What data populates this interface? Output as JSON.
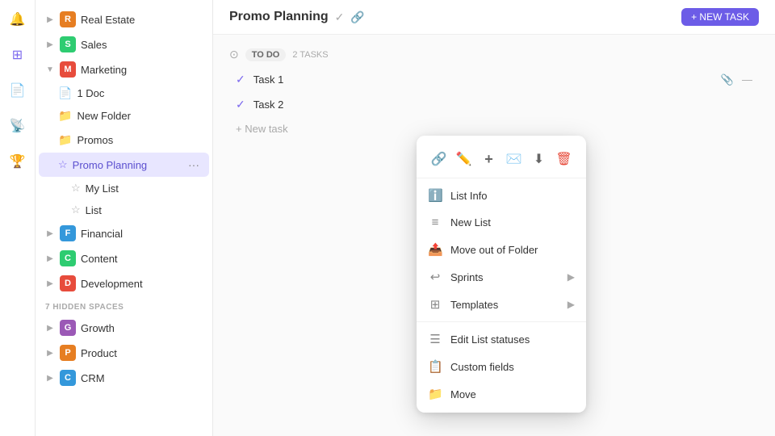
{
  "iconBar": {
    "icons": [
      {
        "name": "bell-icon",
        "symbol": "🔔"
      },
      {
        "name": "grid-icon",
        "symbol": "⊞"
      },
      {
        "name": "doc-icon",
        "symbol": "📄"
      },
      {
        "name": "radio-icon",
        "symbol": "📡"
      },
      {
        "name": "trophy-icon",
        "symbol": "🏆"
      }
    ]
  },
  "sidebar": {
    "spaces": [
      {
        "id": "real-estate",
        "label": "Real Estate",
        "color": "#e67e22",
        "initial": "R",
        "collapsed": true
      },
      {
        "id": "sales",
        "label": "Sales",
        "color": "#2ecc71",
        "initial": "S",
        "collapsed": true
      },
      {
        "id": "marketing",
        "label": "Marketing",
        "color": "#e74c3c",
        "initial": "M",
        "collapsed": false
      }
    ],
    "marketingItems": [
      {
        "type": "doc",
        "label": "1 Doc"
      },
      {
        "type": "folder",
        "label": "New Folder"
      },
      {
        "type": "folder",
        "label": "Promos",
        "hasActions": true
      },
      {
        "type": "list",
        "label": "Promo Planning",
        "active": true,
        "hasThreeDots": true
      },
      {
        "type": "list",
        "label": "My List",
        "indent": true
      },
      {
        "type": "list",
        "label": "List",
        "indent": true
      }
    ],
    "moreSpaces": [
      {
        "id": "financial",
        "label": "Financial",
        "color": "#3498db",
        "initial": "F",
        "collapsed": true
      },
      {
        "id": "content",
        "label": "Content",
        "color": "#2ecc71",
        "initial": "C",
        "collapsed": true
      },
      {
        "id": "development",
        "label": "Development",
        "color": "#e74c3c",
        "initial": "D",
        "collapsed": true
      }
    ],
    "hiddenSpacesLabel": "7 HIDDEN SPACES",
    "hiddenSpaces": [
      {
        "id": "growth",
        "label": "Growth",
        "color": "#9b59b6",
        "initial": "G",
        "collapsed": true
      },
      {
        "id": "product",
        "label": "Product",
        "color": "#e67e22",
        "initial": "P",
        "collapsed": true
      },
      {
        "id": "crm",
        "label": "CRM",
        "color": "#3498db",
        "initial": "C",
        "collapsed": true
      }
    ]
  },
  "main": {
    "header": {
      "title": "Promo Planning"
    },
    "section": {
      "statusLabel": "TO DO",
      "taskCount": "2 TASKS",
      "tasks": [
        {
          "name": "Task 1"
        },
        {
          "name": "Task 2"
        }
      ],
      "newTaskLabel": "+ New task"
    }
  },
  "contextMenu": {
    "toolbar": {
      "linkIcon": "🔗",
      "editIcon": "✏️",
      "plusIcon": "+",
      "emailIcon": "✉️",
      "downloadIcon": "⬇",
      "deleteIcon": "🗑"
    },
    "items": [
      {
        "id": "list-info",
        "icon": "ℹ️",
        "label": "List Info",
        "arrow": false
      },
      {
        "id": "new-list",
        "icon": "≡",
        "label": "New List",
        "arrow": false
      },
      {
        "id": "move-out",
        "icon": "📤",
        "label": "Move out of Folder",
        "arrow": false
      },
      {
        "id": "sprints",
        "icon": "↩",
        "label": "Sprints",
        "arrow": true
      },
      {
        "id": "templates",
        "icon": "⊞",
        "label": "Templates",
        "arrow": true
      },
      {
        "id": "divider1"
      },
      {
        "id": "edit-statuses",
        "icon": "☰",
        "label": "Edit List statuses",
        "arrow": false
      },
      {
        "id": "custom-fields",
        "icon": "📋",
        "label": "Custom fields",
        "arrow": false
      },
      {
        "id": "move",
        "icon": "📁",
        "label": "Move",
        "arrow": false
      }
    ]
  }
}
